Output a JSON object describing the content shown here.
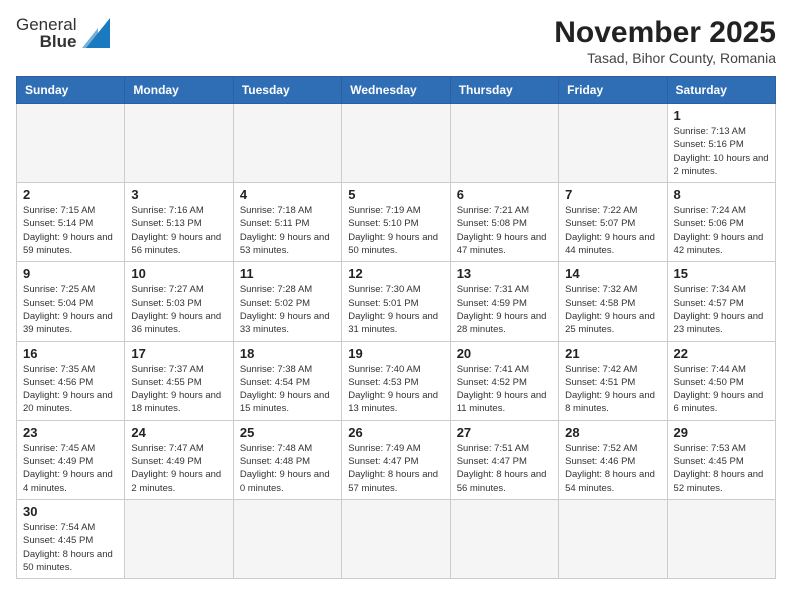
{
  "logo": {
    "line1": "General",
    "line2": "Blue"
  },
  "title": "November 2025",
  "subtitle": "Tasad, Bihor County, Romania",
  "weekdays": [
    "Sunday",
    "Monday",
    "Tuesday",
    "Wednesday",
    "Thursday",
    "Friday",
    "Saturday"
  ],
  "weeks": [
    [
      {
        "day": "",
        "info": ""
      },
      {
        "day": "",
        "info": ""
      },
      {
        "day": "",
        "info": ""
      },
      {
        "day": "",
        "info": ""
      },
      {
        "day": "",
        "info": ""
      },
      {
        "day": "",
        "info": ""
      },
      {
        "day": "1",
        "info": "Sunrise: 7:13 AM\nSunset: 5:16 PM\nDaylight: 10 hours and 2 minutes."
      }
    ],
    [
      {
        "day": "2",
        "info": "Sunrise: 7:15 AM\nSunset: 5:14 PM\nDaylight: 9 hours and 59 minutes."
      },
      {
        "day": "3",
        "info": "Sunrise: 7:16 AM\nSunset: 5:13 PM\nDaylight: 9 hours and 56 minutes."
      },
      {
        "day": "4",
        "info": "Sunrise: 7:18 AM\nSunset: 5:11 PM\nDaylight: 9 hours and 53 minutes."
      },
      {
        "day": "5",
        "info": "Sunrise: 7:19 AM\nSunset: 5:10 PM\nDaylight: 9 hours and 50 minutes."
      },
      {
        "day": "6",
        "info": "Sunrise: 7:21 AM\nSunset: 5:08 PM\nDaylight: 9 hours and 47 minutes."
      },
      {
        "day": "7",
        "info": "Sunrise: 7:22 AM\nSunset: 5:07 PM\nDaylight: 9 hours and 44 minutes."
      },
      {
        "day": "8",
        "info": "Sunrise: 7:24 AM\nSunset: 5:06 PM\nDaylight: 9 hours and 42 minutes."
      }
    ],
    [
      {
        "day": "9",
        "info": "Sunrise: 7:25 AM\nSunset: 5:04 PM\nDaylight: 9 hours and 39 minutes."
      },
      {
        "day": "10",
        "info": "Sunrise: 7:27 AM\nSunset: 5:03 PM\nDaylight: 9 hours and 36 minutes."
      },
      {
        "day": "11",
        "info": "Sunrise: 7:28 AM\nSunset: 5:02 PM\nDaylight: 9 hours and 33 minutes."
      },
      {
        "day": "12",
        "info": "Sunrise: 7:30 AM\nSunset: 5:01 PM\nDaylight: 9 hours and 31 minutes."
      },
      {
        "day": "13",
        "info": "Sunrise: 7:31 AM\nSunset: 4:59 PM\nDaylight: 9 hours and 28 minutes."
      },
      {
        "day": "14",
        "info": "Sunrise: 7:32 AM\nSunset: 4:58 PM\nDaylight: 9 hours and 25 minutes."
      },
      {
        "day": "15",
        "info": "Sunrise: 7:34 AM\nSunset: 4:57 PM\nDaylight: 9 hours and 23 minutes."
      }
    ],
    [
      {
        "day": "16",
        "info": "Sunrise: 7:35 AM\nSunset: 4:56 PM\nDaylight: 9 hours and 20 minutes."
      },
      {
        "day": "17",
        "info": "Sunrise: 7:37 AM\nSunset: 4:55 PM\nDaylight: 9 hours and 18 minutes."
      },
      {
        "day": "18",
        "info": "Sunrise: 7:38 AM\nSunset: 4:54 PM\nDaylight: 9 hours and 15 minutes."
      },
      {
        "day": "19",
        "info": "Sunrise: 7:40 AM\nSunset: 4:53 PM\nDaylight: 9 hours and 13 minutes."
      },
      {
        "day": "20",
        "info": "Sunrise: 7:41 AM\nSunset: 4:52 PM\nDaylight: 9 hours and 11 minutes."
      },
      {
        "day": "21",
        "info": "Sunrise: 7:42 AM\nSunset: 4:51 PM\nDaylight: 9 hours and 8 minutes."
      },
      {
        "day": "22",
        "info": "Sunrise: 7:44 AM\nSunset: 4:50 PM\nDaylight: 9 hours and 6 minutes."
      }
    ],
    [
      {
        "day": "23",
        "info": "Sunrise: 7:45 AM\nSunset: 4:49 PM\nDaylight: 9 hours and 4 minutes."
      },
      {
        "day": "24",
        "info": "Sunrise: 7:47 AM\nSunset: 4:49 PM\nDaylight: 9 hours and 2 minutes."
      },
      {
        "day": "25",
        "info": "Sunrise: 7:48 AM\nSunset: 4:48 PM\nDaylight: 9 hours and 0 minutes."
      },
      {
        "day": "26",
        "info": "Sunrise: 7:49 AM\nSunset: 4:47 PM\nDaylight: 8 hours and 57 minutes."
      },
      {
        "day": "27",
        "info": "Sunrise: 7:51 AM\nSunset: 4:47 PM\nDaylight: 8 hours and 56 minutes."
      },
      {
        "day": "28",
        "info": "Sunrise: 7:52 AM\nSunset: 4:46 PM\nDaylight: 8 hours and 54 minutes."
      },
      {
        "day": "29",
        "info": "Sunrise: 7:53 AM\nSunset: 4:45 PM\nDaylight: 8 hours and 52 minutes."
      }
    ],
    [
      {
        "day": "30",
        "info": "Sunrise: 7:54 AM\nSunset: 4:45 PM\nDaylight: 8 hours and 50 minutes."
      },
      {
        "day": "",
        "info": ""
      },
      {
        "day": "",
        "info": ""
      },
      {
        "day": "",
        "info": ""
      },
      {
        "day": "",
        "info": ""
      },
      {
        "day": "",
        "info": ""
      },
      {
        "day": "",
        "info": ""
      }
    ]
  ]
}
